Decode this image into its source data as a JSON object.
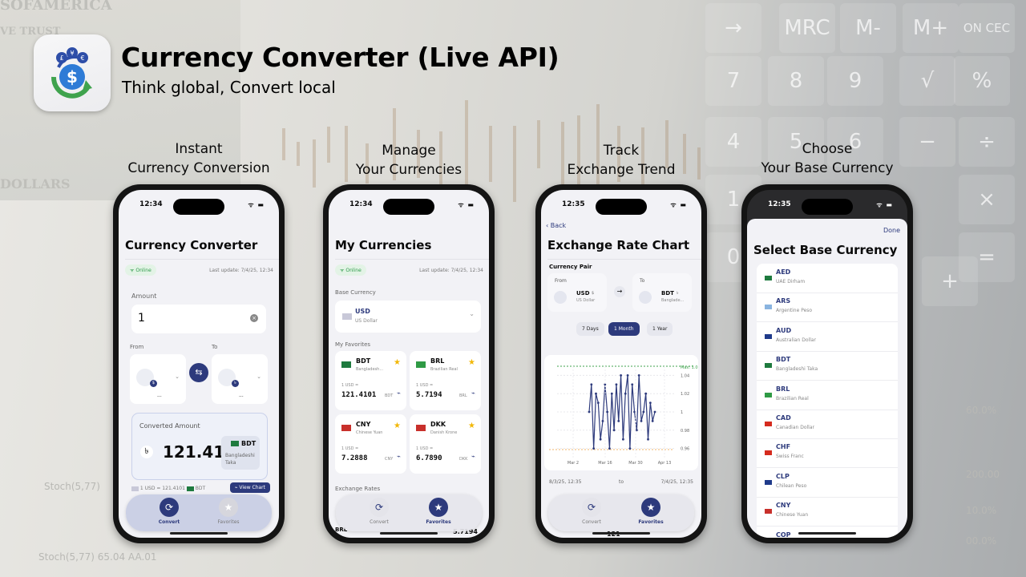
{
  "header": {
    "title": "Currency Converter (Live API)",
    "subtitle": "Think global, Convert local"
  },
  "captions": [
    {
      "line1": "Instant",
      "line2": "Currency Conversion"
    },
    {
      "line1": "Manage",
      "line2": "Your Currencies"
    },
    {
      "line1": "Track",
      "line2": "Exchange Trend"
    },
    {
      "line1": "Choose",
      "line2": "Your Base Currency"
    }
  ],
  "background_text": {
    "note_top": "SOFAMERICA",
    "note_trust": "VE TRUST",
    "note_dollars": "DOLLARS",
    "stock1": "Stoch(5,77)",
    "stock2": "Stoch(5,77) 65.04 AA.01",
    "calc_keys": [
      "→",
      "MRC",
      "M-",
      "M+",
      "ON CEC",
      "7",
      "8",
      "9",
      "√",
      "%",
      "4",
      "5",
      "6",
      "−",
      "÷",
      "1",
      "×",
      "0",
      "=",
      "+"
    ],
    "right_nums": [
      "200.00",
      "10.0%",
      "00.0%",
      "60.0%"
    ]
  },
  "phone1": {
    "time": "12:34",
    "title": "Currency Converter",
    "status": "Online",
    "last_update": "Last update: 7/4/25, 12:34",
    "amount_label": "Amount",
    "amount_value": "1",
    "from_label": "From",
    "to_label": "To",
    "from_placeholder": "...",
    "to_placeholder": "...",
    "converted_label": "Converted Amount",
    "converted_symbol": "৳",
    "converted_value": "121.41",
    "target_code": "BDT",
    "target_name": "Bangladeshi Taka",
    "rate_text": "1 USD = 121.4101",
    "rate_code": "BDT",
    "view_chart": "View Chart",
    "tabs": [
      "Convert",
      "Favorites"
    ]
  },
  "phone2": {
    "time": "12:34",
    "title": "My Currencies",
    "status": "Online",
    "last_update": "Last update: 7/4/25, 12:34",
    "base_label": "Base Currency",
    "base_code": "USD",
    "base_name": "US Dollar",
    "favorites_label": "My Favorites",
    "favorites": [
      {
        "code": "BDT",
        "name": "Bangladesh...",
        "rate_label": "1 USD =",
        "rate": "121.4101",
        "unit": "BDT"
      },
      {
        "code": "BRL",
        "name": "Brazilian Real",
        "rate_label": "1 USD =",
        "rate": "5.7194",
        "unit": "BRL"
      },
      {
        "code": "CNY",
        "name": "Chinese Yuan",
        "rate_label": "1 USD =",
        "rate": "7.2888",
        "unit": "CNY"
      },
      {
        "code": "DKK",
        "name": "Danish Krone",
        "rate_label": "1 USD =",
        "rate": "6.7890",
        "unit": "DKK"
      }
    ],
    "exchange_label": "Exchange Rates",
    "peek_code": "BRL",
    "peek_value": "5.7194",
    "tabs": [
      "Convert",
      "Favorites"
    ]
  },
  "phone3": {
    "time": "12:35",
    "back": "Back",
    "title": "Exchange Rate Chart",
    "pair_label": "Currency Pair",
    "from_label": "From",
    "to_label": "To",
    "from_code": "USD",
    "from_symbol": "$",
    "from_name": "US Dollar",
    "to_code": "BDT",
    "to_symbol": "৳",
    "to_name": "Banglade...",
    "ranges": [
      "7 Days",
      "1 Month",
      "1 Year"
    ],
    "active_range": "1 Month",
    "max_label": "Max: 1.0",
    "date_from": "8/3/25, 12:35",
    "date_to_word": "to",
    "date_to": "7/4/25, 12:35",
    "peek_value": "121",
    "tabs": [
      "Convert",
      "Favorites"
    ]
  },
  "chart_data": {
    "type": "line",
    "x_ticks": [
      "Mar 2",
      "Mar 16",
      "Mar 30",
      "Apr 13"
    ],
    "y_ticks": [
      1.04,
      1.02,
      1.0,
      0.98,
      0.96
    ],
    "ylim": [
      0.95,
      1.05
    ],
    "series": [
      {
        "values": [
          1.0,
          1.03,
          0.96,
          1.02,
          1.01,
          0.97,
          0.99,
          1.03,
          1.0,
          0.96,
          1.02,
          0.98,
          1.03,
          0.99,
          1.04,
          0.97,
          1.02,
          1.04,
          0.96,
          1.03,
          1.0,
          0.98,
          1.04,
          0.99,
          1.0,
          1.02,
          0.97,
          1.01,
          0.99,
          1.0
        ]
      }
    ],
    "grid": true
  },
  "phone4": {
    "time": "12:35",
    "done": "Done",
    "title": "Select Base Currency",
    "currencies": [
      {
        "code": "AED",
        "name": "UAE Dirham"
      },
      {
        "code": "ARS",
        "name": "Argentine Peso"
      },
      {
        "code": "AUD",
        "name": "Australian Dollar"
      },
      {
        "code": "BDT",
        "name": "Bangladeshi Taka"
      },
      {
        "code": "BRL",
        "name": "Brazilian Real"
      },
      {
        "code": "CAD",
        "name": "Canadian Dollar"
      },
      {
        "code": "CHF",
        "name": "Swiss Franc"
      },
      {
        "code": "CLP",
        "name": "Chilean Peso"
      },
      {
        "code": "CNY",
        "name": "Chinese Yuan"
      },
      {
        "code": "COP",
        "name": ""
      }
    ]
  },
  "colors": {
    "accent": "#2d3a7c",
    "online": "#2e9b4a",
    "star": "#f2b705"
  }
}
